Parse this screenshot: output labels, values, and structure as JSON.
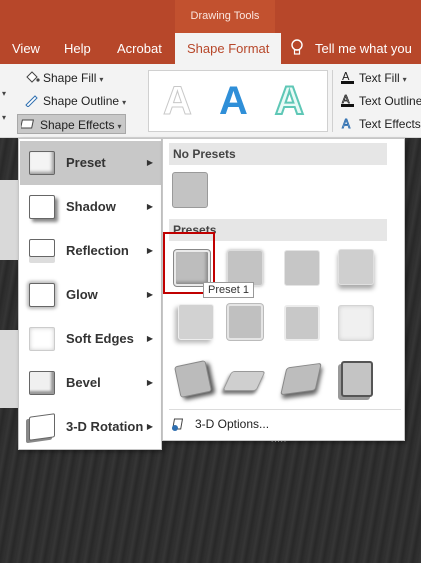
{
  "context_tab_group": "Drawing Tools",
  "tabs": [
    {
      "label": "View"
    },
    {
      "label": "Help"
    },
    {
      "label": "Acrobat"
    },
    {
      "label": "Shape Format"
    },
    {
      "label": "Tell me what you wa"
    }
  ],
  "ribbon": {
    "shape_fill": "Shape Fill",
    "shape_outline": "Shape Outline",
    "shape_effects": "Shape Effects",
    "text_fill": "Text Fill",
    "text_outline": "Text Outline",
    "text_effects": "Text Effects",
    "wordart_letters": [
      "A",
      "A",
      "A"
    ]
  },
  "effects_menu": {
    "items": [
      {
        "label": "Preset",
        "mnemonic": "P"
      },
      {
        "label": "Shadow",
        "mnemonic": "S"
      },
      {
        "label": "Reflection",
        "mnemonic": "R"
      },
      {
        "label": "Glow",
        "mnemonic": "G"
      },
      {
        "label": "Soft Edges",
        "mnemonic": "E"
      },
      {
        "label": "Bevel",
        "mnemonic": "B"
      },
      {
        "label": "3-D Rotation",
        "mnemonic": "D"
      }
    ]
  },
  "flyout": {
    "no_presets_header": "No Presets",
    "presets_header": "Presets",
    "tooltip": "Preset 1",
    "options_label": "3-D Options...",
    "grip": "....."
  },
  "colors": {
    "accent": "#b7472a",
    "selection_border": "#c00000",
    "wordart_blue": "#2f8fd8",
    "wordart_teal": "#5ec7b6"
  },
  "icons": [
    "lightbulb-icon",
    "shape-fill-icon",
    "shape-outline-icon",
    "shape-effects-icon",
    "text-fill-icon",
    "text-outline-icon",
    "text-effects-icon",
    "3d-options-icon",
    "submenu-arrow-icon"
  ]
}
